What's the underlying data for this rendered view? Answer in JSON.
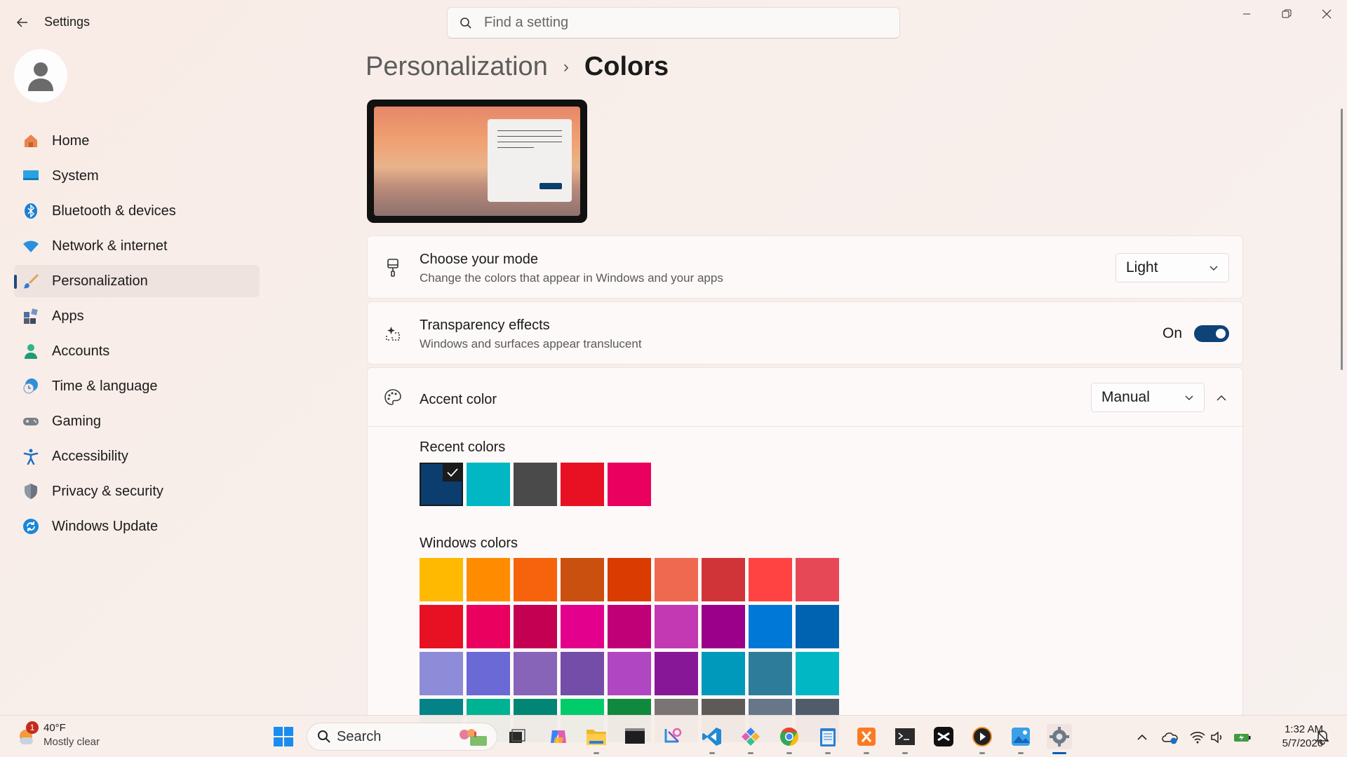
{
  "app": {
    "title": "Settings"
  },
  "search": {
    "placeholder": "Find a setting"
  },
  "sidebar": {
    "items": [
      {
        "label": "Home",
        "icon": "home-icon"
      },
      {
        "label": "System",
        "icon": "system-icon"
      },
      {
        "label": "Bluetooth & devices",
        "icon": "bluetooth-icon"
      },
      {
        "label": "Network & internet",
        "icon": "wifi-icon"
      },
      {
        "label": "Personalization",
        "icon": "brush-icon",
        "active": true
      },
      {
        "label": "Apps",
        "icon": "apps-icon"
      },
      {
        "label": "Accounts",
        "icon": "accounts-icon"
      },
      {
        "label": "Time & language",
        "icon": "clock-globe-icon"
      },
      {
        "label": "Gaming",
        "icon": "gamepad-icon"
      },
      {
        "label": "Accessibility",
        "icon": "accessibility-icon"
      },
      {
        "label": "Privacy & security",
        "icon": "shield-icon"
      },
      {
        "label": "Windows Update",
        "icon": "update-icon"
      }
    ]
  },
  "breadcrumb": {
    "parent": "Personalization",
    "separator": "›",
    "current": "Colors"
  },
  "mode": {
    "title": "Choose your mode",
    "subtitle": "Change the colors that appear in Windows and your apps",
    "value": "Light"
  },
  "transparency": {
    "title": "Transparency effects",
    "subtitle": "Windows and surfaces appear translucent",
    "state_label": "On",
    "on": true
  },
  "accent": {
    "title": "Accent color",
    "value": "Manual",
    "recent_label": "Recent colors",
    "recent_colors": [
      "#0b3d6e",
      "#00b7c3",
      "#4a4a4a",
      "#e81123",
      "#ea005e"
    ],
    "selected_index": 0,
    "windows_label": "Windows colors",
    "windows_colors": [
      [
        "#ffb900",
        "#ff8c00",
        "#f7630c",
        "#ca5010",
        "#da3b01",
        "#ef6950",
        "#d13438",
        "#ff4343",
        "#e74856"
      ],
      [
        "#e81123",
        "#ea005e",
        "#c30052",
        "#e3008c",
        "#bf0077",
        "#c239b3",
        "#9a0089",
        "#0078d7",
        "#0063b1"
      ],
      [
        "#8e8cd8",
        "#6b69d6",
        "#8764b8",
        "#744da9",
        "#b146c2",
        "#881798",
        "#0099bc",
        "#2d7d9a",
        "#00b7c3"
      ],
      [
        "#038387",
        "#00b294",
        "#018574",
        "#00cc6a",
        "#10893e",
        "#7a7574",
        "#5d5a58",
        "#68768a",
        "#515c6b"
      ]
    ]
  },
  "taskbar": {
    "weather": {
      "temp": "40°F",
      "condition": "Mostly clear",
      "badge": "1"
    },
    "search_label": "Search",
    "apps": [
      "start-icon",
      "task-view-icon",
      "copilot-icon",
      "file-explorer-icon",
      "terminal-icon",
      "snipping-tool-icon",
      "vscode-icon",
      "app-icon",
      "chrome-icon",
      "notepad-icon",
      "xampp-icon",
      "cmd-icon",
      "capcut-icon",
      "media-player-icon",
      "photos-icon",
      "settings-icon"
    ]
  },
  "clock": {
    "time": "1:32 AM",
    "date": "5/7/2026"
  },
  "colors": {
    "accent": "#0b3d6e",
    "active_indicator": "#1e4a7a"
  }
}
